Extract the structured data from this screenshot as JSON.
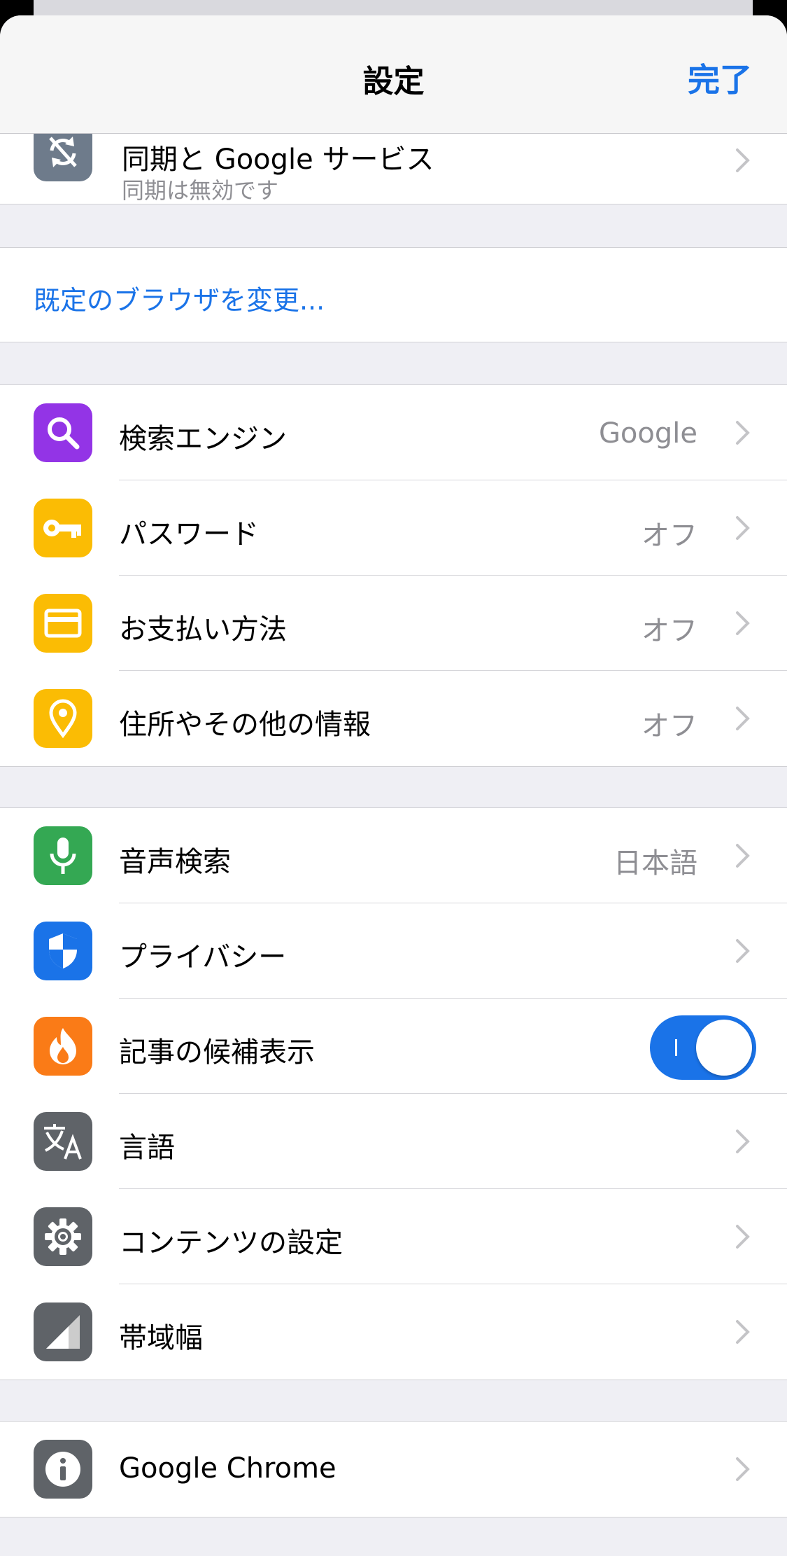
{
  "nav": {
    "title": "設定",
    "done": "完了"
  },
  "sync": {
    "title": "同期と Google サービス",
    "subtitle": "同期は無効です"
  },
  "default_browser": {
    "label": "既定のブラウザを変更..."
  },
  "autofill": [
    {
      "id": "search-engine",
      "label": "検索エンジン",
      "value": "Google",
      "icon": "search-icon",
      "color": "#9334e6"
    },
    {
      "id": "passwords",
      "label": "パスワード",
      "value": "オフ",
      "icon": "key-icon",
      "color": "#fbbc04"
    },
    {
      "id": "payment",
      "label": "お支払い方法",
      "value": "オフ",
      "icon": "credit-card-icon",
      "color": "#fbbc04"
    },
    {
      "id": "addresses",
      "label": "住所やその他の情報",
      "value": "オフ",
      "icon": "location-pin-icon",
      "color": "#fbbc04"
    }
  ],
  "advanced": [
    {
      "id": "voice-search",
      "label": "音声検索",
      "value": "日本語",
      "icon": "microphone-icon",
      "color": "#34a853"
    },
    {
      "id": "privacy",
      "label": "プライバシー",
      "value": "",
      "icon": "shield-icon",
      "color": "#1a73e8"
    },
    {
      "id": "article-suggestions",
      "label": "記事の候補表示",
      "toggle": true,
      "icon": "flame-icon",
      "color": "#fa7b17"
    },
    {
      "id": "languages",
      "label": "言語",
      "value": "",
      "icon": "translate-icon",
      "color": "#5f6368"
    },
    {
      "id": "content-settings",
      "label": "コンテンツの設定",
      "value": "",
      "icon": "gear-icon",
      "color": "#5f6368"
    },
    {
      "id": "bandwidth",
      "label": "帯域幅",
      "value": "",
      "icon": "signal-icon",
      "color": "#5f6368"
    }
  ],
  "about": {
    "label": "Google Chrome",
    "icon": "info-icon",
    "color": "#5f6368"
  }
}
